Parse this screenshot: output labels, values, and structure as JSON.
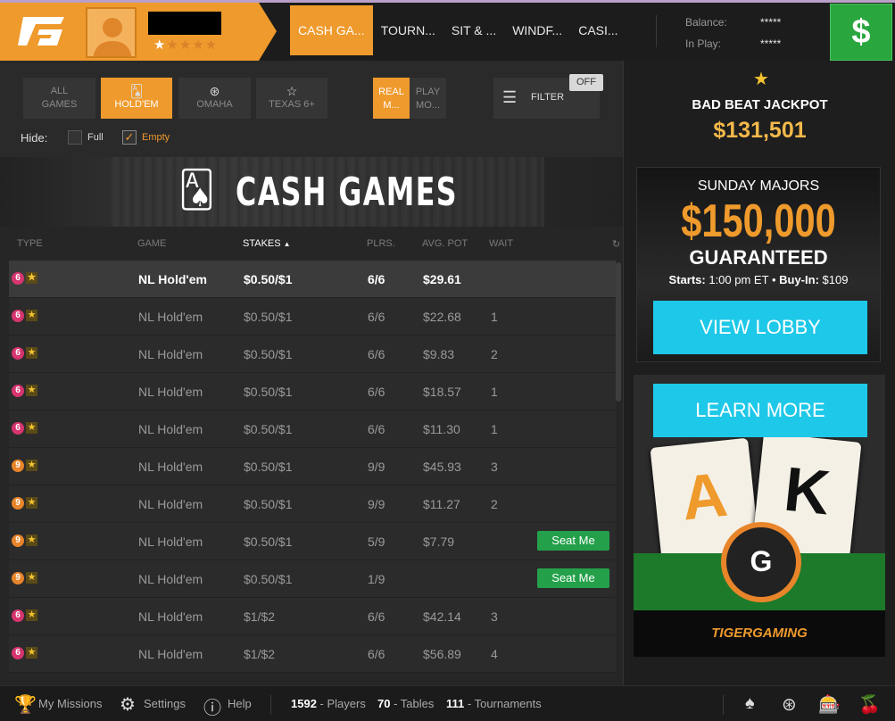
{
  "header": {
    "rating_stars_filled": 1,
    "rating_stars_total": 5,
    "nav_tabs": [
      {
        "label": "CASH GA...",
        "active": true
      },
      {
        "label": "TOURN...",
        "active": false
      },
      {
        "label": "SIT & ...",
        "active": false
      },
      {
        "label": "WINDF...",
        "active": false
      },
      {
        "label": "CASI...",
        "active": false
      }
    ],
    "balance_label": "Balance:",
    "balance_value": "*****",
    "inplay_label": "In Play:",
    "inplay_value": "*****",
    "cashier_symbol": "$"
  },
  "filters": {
    "game_types": [
      {
        "label": "ALL GAMES",
        "icon": "none",
        "active": false
      },
      {
        "label": "HOLD'EM",
        "icon": "cards-icon",
        "active": true
      },
      {
        "label": "OMAHA",
        "icon": "chip-icon",
        "active": false
      },
      {
        "label": "TEXAS 6+",
        "icon": "star-icon",
        "active": false
      }
    ],
    "modes": [
      {
        "label_line1": "REAL",
        "label_line2": "M...",
        "active": true
      },
      {
        "label_line1": "PLAY",
        "label_line2": "MO...",
        "active": false
      }
    ],
    "filter_label": "FILTER",
    "filter_state": "OFF",
    "hide_label": "Hide:",
    "hide_full_label": "Full",
    "hide_full_checked": false,
    "hide_empty_label": "Empty",
    "hide_empty_checked": true
  },
  "banner": {
    "title": "CASH GAMES"
  },
  "table": {
    "columns": {
      "type": "TYPE",
      "game": "GAME",
      "stakes": "STAKES",
      "plrs": "PLRS.",
      "avg_pot": "AVG. POT",
      "wait": "WAIT"
    },
    "sort_indicator": "▲",
    "rows": [
      {
        "seats": "6",
        "game": "NL Hold'em",
        "stakes": "$0.50/$1",
        "plrs": "6/6",
        "avg_pot": "$29.61",
        "wait": "",
        "seat_me": "",
        "selected": true
      },
      {
        "seats": "6",
        "game": "NL Hold'em",
        "stakes": "$0.50/$1",
        "plrs": "6/6",
        "avg_pot": "$22.68",
        "wait": "1",
        "seat_me": ""
      },
      {
        "seats": "6",
        "game": "NL Hold'em",
        "stakes": "$0.50/$1",
        "plrs": "6/6",
        "avg_pot": "$9.83",
        "wait": "2",
        "seat_me": ""
      },
      {
        "seats": "6",
        "game": "NL Hold'em",
        "stakes": "$0.50/$1",
        "plrs": "6/6",
        "avg_pot": "$18.57",
        "wait": "1",
        "seat_me": ""
      },
      {
        "seats": "6",
        "game": "NL Hold'em",
        "stakes": "$0.50/$1",
        "plrs": "6/6",
        "avg_pot": "$11.30",
        "wait": "1",
        "seat_me": ""
      },
      {
        "seats": "9",
        "game": "NL Hold'em",
        "stakes": "$0.50/$1",
        "plrs": "9/9",
        "avg_pot": "$45.93",
        "wait": "3",
        "seat_me": ""
      },
      {
        "seats": "9",
        "game": "NL Hold'em",
        "stakes": "$0.50/$1",
        "plrs": "9/9",
        "avg_pot": "$11.27",
        "wait": "2",
        "seat_me": ""
      },
      {
        "seats": "9",
        "game": "NL Hold'em",
        "stakes": "$0.50/$1",
        "plrs": "5/9",
        "avg_pot": "$7.79",
        "wait": "",
        "seat_me": "Seat Me"
      },
      {
        "seats": "9",
        "game": "NL Hold'em",
        "stakes": "$0.50/$1",
        "plrs": "1/9",
        "avg_pot": "",
        "wait": "",
        "seat_me": "Seat Me"
      },
      {
        "seats": "6",
        "game": "NL Hold'em",
        "stakes": "$1/$2",
        "plrs": "6/6",
        "avg_pot": "$42.14",
        "wait": "3",
        "seat_me": ""
      },
      {
        "seats": "6",
        "game": "NL Hold'em",
        "stakes": "$1/$2",
        "plrs": "6/6",
        "avg_pot": "$56.89",
        "wait": "4",
        "seat_me": ""
      }
    ]
  },
  "jackpot": {
    "title": "BAD BEAT JACKPOT",
    "amount": "$131,501"
  },
  "promo_majors": {
    "subtitle": "SUNDAY MAJORS",
    "amount": "$150,000",
    "guaranteed": "GUARANTEED",
    "starts_label": "Starts:",
    "starts_value": "1:00 pm ET",
    "bullet": "•",
    "buyin_label": "Buy-In:",
    "buyin_value": "$109",
    "button": "VIEW LOBBY"
  },
  "promo_tiger": {
    "button": "LEARN MORE",
    "card1": "A",
    "card2": "K",
    "brand": "TIGERGAMING"
  },
  "footer": {
    "missions": "My Missions",
    "settings": "Settings",
    "help": "Help",
    "players_count": "1592",
    "players_label": "- Players",
    "tables_count": "70",
    "tables_label": "- Tables",
    "tournaments_count": "111",
    "tournaments_label": "- Tournaments"
  },
  "colors": {
    "accent": "#ef9a2c",
    "cashier": "#2aa63e",
    "cta": "#1ec8e8",
    "gold": "#f4b94a"
  }
}
